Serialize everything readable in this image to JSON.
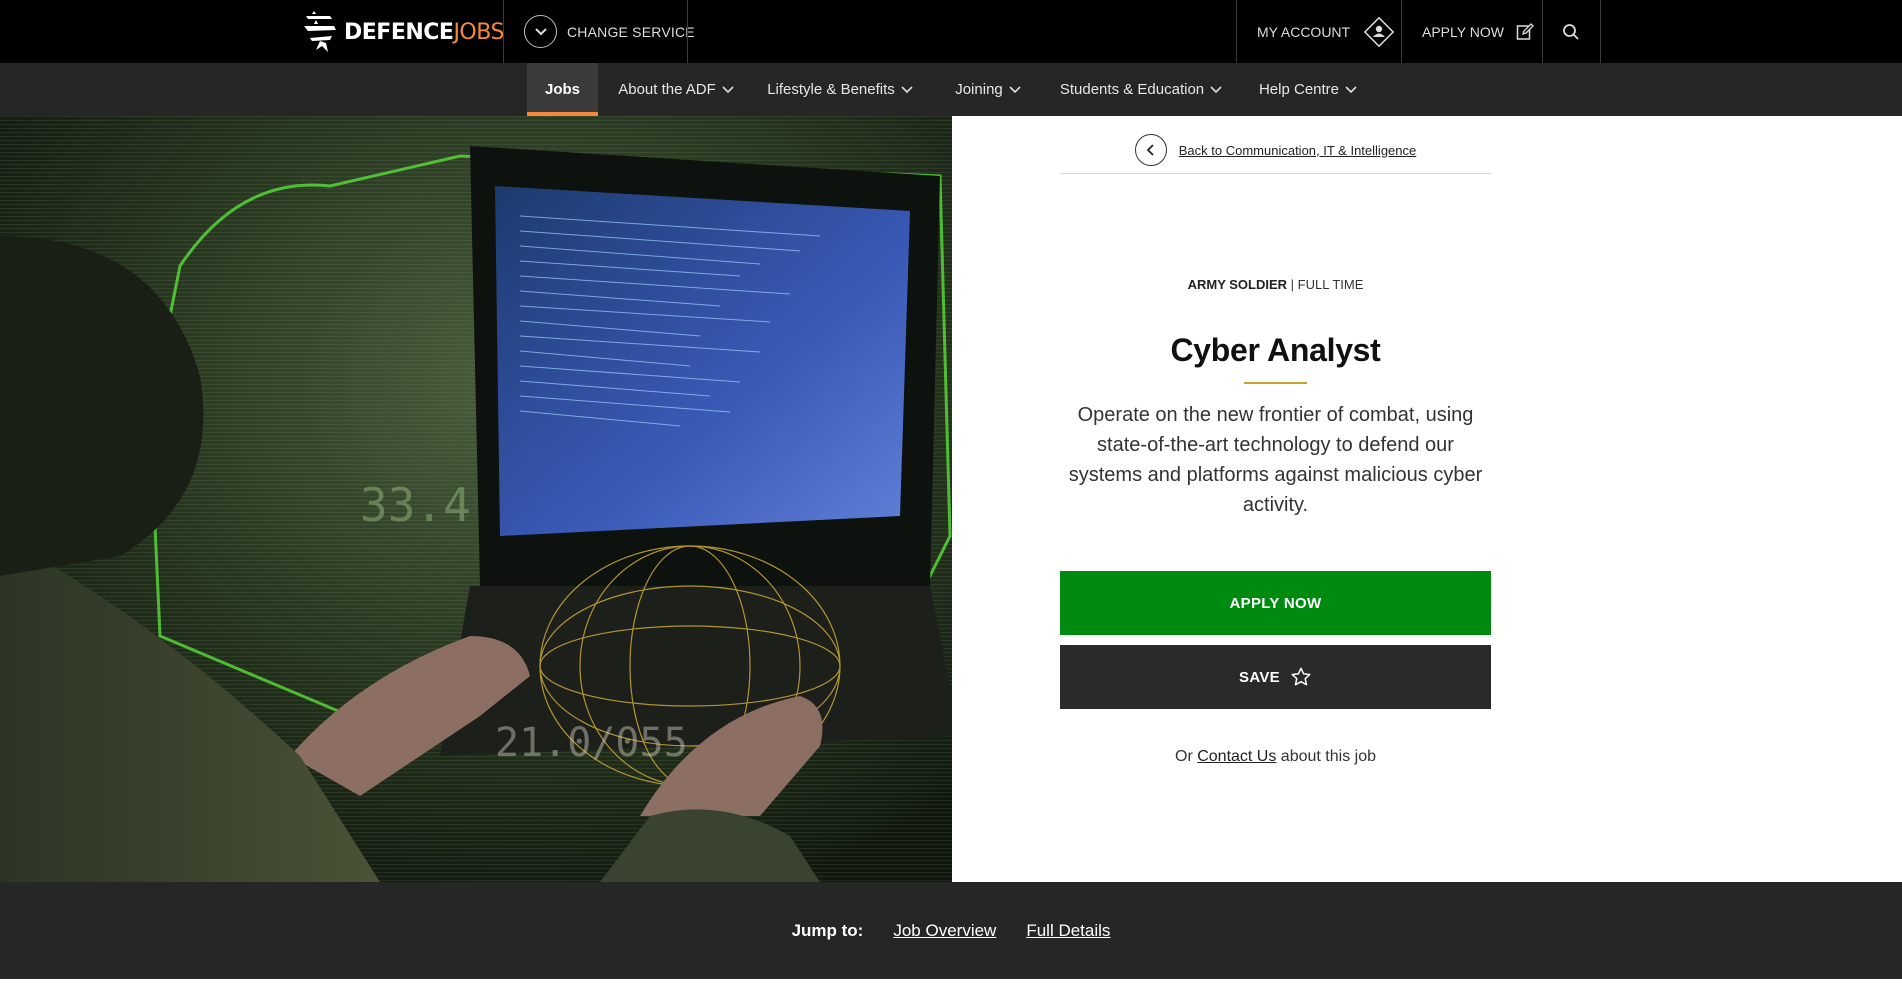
{
  "header": {
    "logo": {
      "word1": "DEFENCE",
      "word2": "JOBS"
    },
    "change_service": "CHANGE SERVICE",
    "my_account": "MY ACCOUNT",
    "apply_now": "APPLY NOW",
    "accent_color": "#f5893b"
  },
  "nav": {
    "items": [
      {
        "label": "Jobs",
        "active": true,
        "dropdown": false
      },
      {
        "label": "About the ADF",
        "dropdown": true
      },
      {
        "label": "Lifestyle & Benefits",
        "dropdown": true
      },
      {
        "label": "Joining",
        "dropdown": true
      },
      {
        "label": "Students & Education",
        "dropdown": true
      },
      {
        "label": "Help Centre",
        "dropdown": true
      }
    ]
  },
  "hero": {
    "overlay_text_1": "33.4",
    "overlay_text_2": "21.0/055"
  },
  "job": {
    "back_link": "Back to Communication, IT & Intelligence",
    "service": "ARMY SOLDIER",
    "separator": " | ",
    "type": "FULL TIME",
    "title": "Cyber Analyst",
    "description": "Operate on the new frontier of combat, using state-of-the-art technology to defend our systems and platforms against malicious cyber activity.",
    "apply_label": "APPLY NOW",
    "save_label": "SAVE",
    "contact_prefix": "Or ",
    "contact_link": "Contact Us",
    "contact_suffix": " about this job",
    "apply_color": "#008a10"
  },
  "jump": {
    "label": "Jump to:",
    "links": [
      "Job Overview",
      "Full Details"
    ]
  }
}
